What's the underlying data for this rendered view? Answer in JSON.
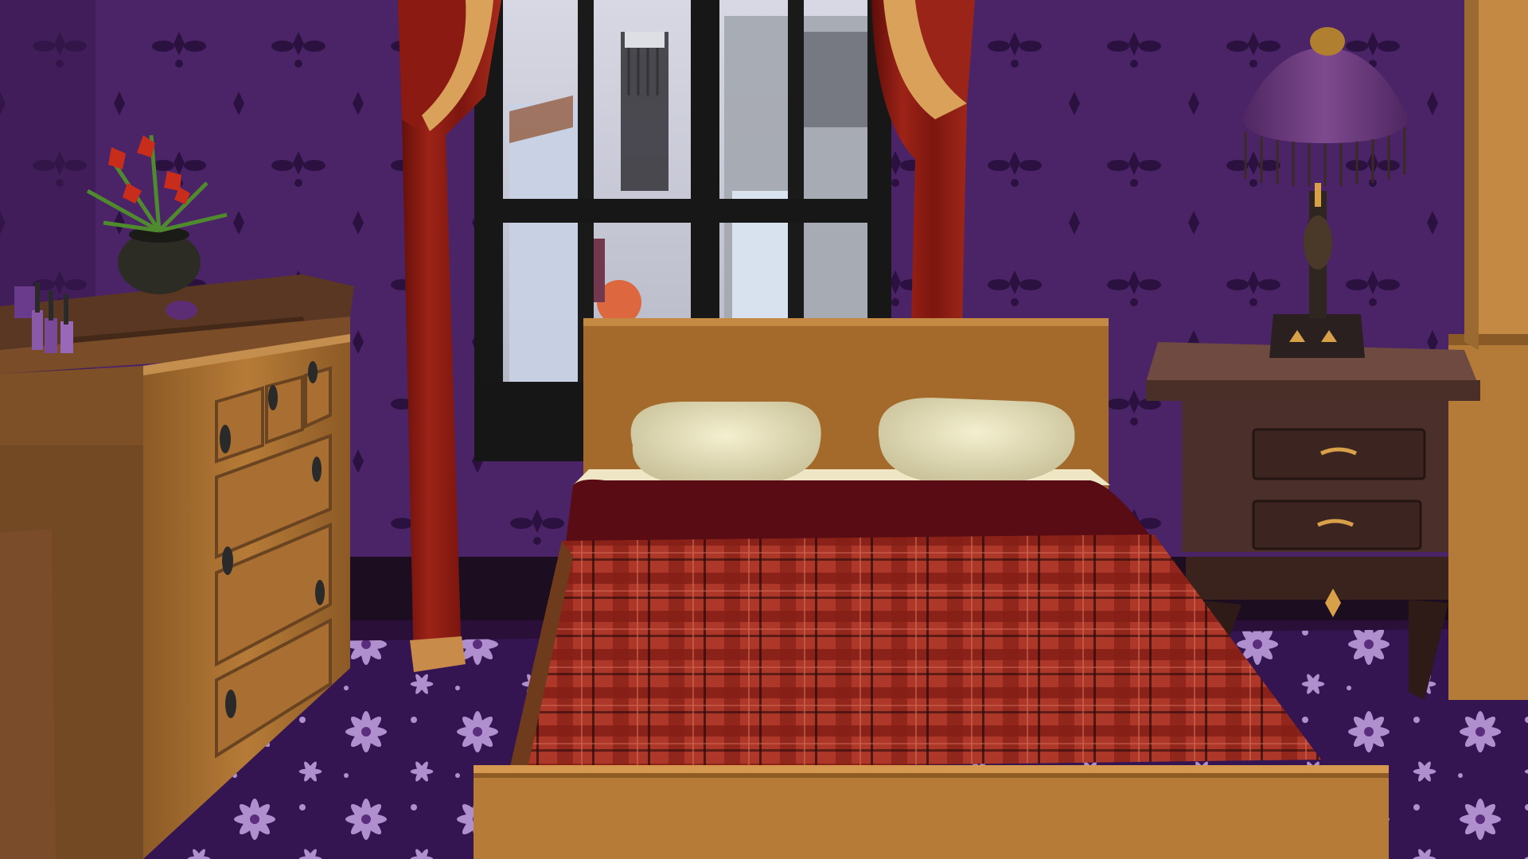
{
  "scene": {
    "description_room": "bedroom",
    "palette": {
      "wall": "#4a2466",
      "wall_motif": "#2c1240",
      "carpet": "#3a1656",
      "carpet_flower": "#a77fc6",
      "wood": "#a8702f",
      "wood_dark": "#6e4420",
      "curtain": "#8c1b14",
      "curtain_trim": "#d9a15a",
      "plaid": "#b43b2a",
      "blanket_dark": "#5a0c14",
      "pillow": "#e9e3bd",
      "nightstand": "#4a2f28",
      "lampshade": "#6a3a7c",
      "window_frame": "#141414"
    },
    "objects": [
      {
        "name": "window",
        "icon": "window-icon"
      },
      {
        "name": "left-curtain",
        "icon": "curtain-icon"
      },
      {
        "name": "right-curtain",
        "icon": "curtain-icon"
      },
      {
        "name": "double-bed",
        "icon": "bed-icon"
      },
      {
        "name": "dresser",
        "icon": "dresser-icon"
      },
      {
        "name": "flower-vase",
        "icon": "flower-icon"
      },
      {
        "name": "nail-polish-bottles",
        "icon": "bottle-icon"
      },
      {
        "name": "nightstand",
        "icon": "nightstand-icon"
      },
      {
        "name": "table-lamp",
        "icon": "lamp-icon"
      },
      {
        "name": "wardrobe",
        "icon": "wardrobe-icon"
      }
    ]
  }
}
